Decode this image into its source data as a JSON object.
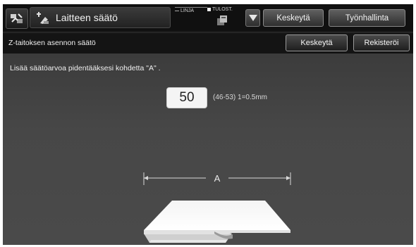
{
  "header": {
    "title": "Laitteen säätö",
    "linja_label": "LINJA",
    "tulost_label": "TULOST.",
    "stop_label": "Keskeytä",
    "jobs_label": "Työnhallinta"
  },
  "subheader": {
    "title": "Z-taitoksen asennon säätö",
    "cancel_label": "Keskeytä",
    "register_label": "Rekisteröi"
  },
  "main": {
    "instruction": "Lisää säätöarvoa pidentääksesi kohdetta \"A\" .",
    "value": "50",
    "range_text": "(46-53) 1=0.5mm",
    "diagram_label": "A"
  },
  "colors": {
    "background": "#1c1c1c",
    "content": "#484848",
    "accent": "#9a9a9a"
  },
  "icons": [
    "settings-icon",
    "adjust-icon",
    "printer-icon",
    "chevron-down-icon"
  ]
}
